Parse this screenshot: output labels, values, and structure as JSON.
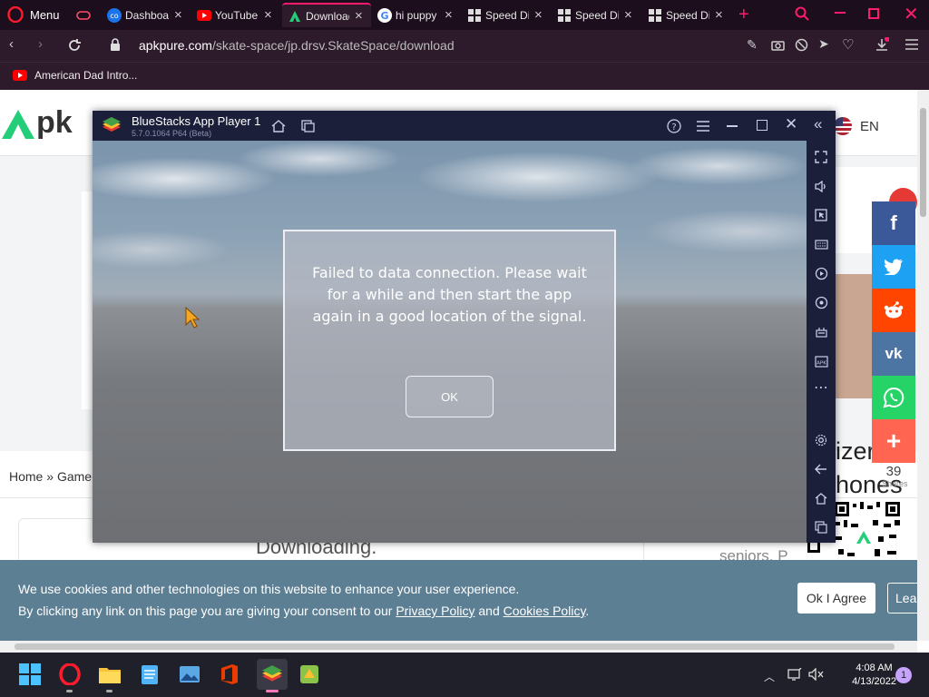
{
  "browser": {
    "menu_label": "Menu",
    "tabs": [
      {
        "title": "Dashboard",
        "icon": "dashboard-icon"
      },
      {
        "title": "YouTube",
        "icon": "youtube-icon"
      },
      {
        "title": "Download",
        "icon": "apkpure-icon",
        "active": true
      },
      {
        "title": "hi puppy",
        "icon": "google-icon"
      },
      {
        "title": "Speed Dial",
        "icon": "speed-dial-icon"
      },
      {
        "title": "Speed Dial",
        "icon": "speed-dial-icon"
      },
      {
        "title": "Speed Dial",
        "icon": "speed-dial-icon"
      }
    ],
    "url_host": "apkpure.com",
    "url_path": "/skate-space/jp.drsv.SkateSpace/download",
    "bookmark": "American Dad Intro..."
  },
  "page": {
    "logo_text": "APKPURE",
    "lang": "EN",
    "breadcrumb_home": "Home",
    "breadcrumb_sep": "»",
    "breadcrumb_next": "Game",
    "downloading": "Downloading.",
    "side_text_1": "izer",
    "side_text_2": "hones",
    "seniors_text": "seniors. P",
    "share_count": "39",
    "share_count_label": "Shares",
    "share_buttons": [
      "facebook",
      "twitter",
      "reddit",
      "vk",
      "whatsapp",
      "more"
    ],
    "colors": {
      "facebook": "#3b5998",
      "twitter": "#1da1f2",
      "reddit": "#ff4500",
      "vk": "#4c75a3",
      "whatsapp": "#25d366",
      "more": "#ff6550"
    }
  },
  "cookie": {
    "line1": "We use cookies and other technologies on this website to enhance your user experience.",
    "line2_prefix": "By clicking any link on this page you are giving your consent to our ",
    "privacy": "Privacy Policy",
    "and": " and ",
    "cookies": "Cookies Policy",
    "period": ".",
    "agree": "Ok I Agree",
    "learn": "Lea"
  },
  "bluestacks": {
    "title": "BlueStacks App Player 1",
    "version": "5.7.0.1064  P64 (Beta)",
    "dialog_message": "Failed to data connection. Please wait for a while and then start the app again in a good location of the signal.",
    "ok_label": "OK"
  },
  "taskbar": {
    "time": "4:08 AM",
    "date": "4/13/2022",
    "notification_count": "1"
  }
}
